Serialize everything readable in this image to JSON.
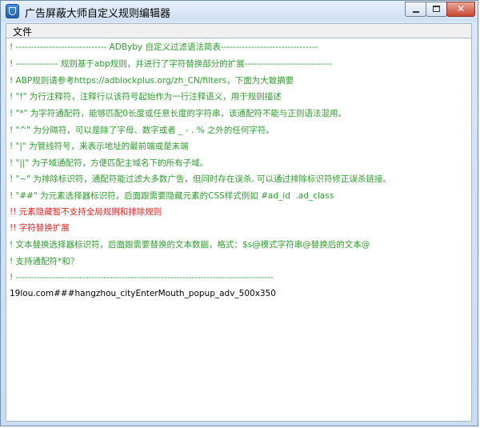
{
  "window": {
    "title": "广告屏蔽大师自定义规则编辑器"
  },
  "menu": {
    "file_label": "文件"
  },
  "editor": {
    "lines": [
      {
        "text": "! ------------------------------ ADByby 自定义过滤语法简表--------------------------------",
        "color": "green"
      },
      {
        "text": "! -------------- 规则基于abp规则，并进行了字符替换部分的扩展-----------------------------",
        "color": "green"
      },
      {
        "text": "! ABP规则请参考https://adblockplus.org/zh_CN/filters，下面为大致摘要",
        "color": "green"
      },
      {
        "text": "! \"!\" 为行注释符，注释行以该符号起始作为一行注释语义，用于规则描述",
        "color": "green"
      },
      {
        "text": "! \"*\" 为字符通配符，能够匹配0长度或任意长度的字符串，该通配符不能与正则语法混用。",
        "color": "green"
      },
      {
        "text": "! \"^\" 为分隔符，可以是除了字母、数字或者 _ - . % 之外的任何字符。",
        "color": "green"
      },
      {
        "text": "! \"|\" 为管线符号，来表示地址的最前端或是末端",
        "color": "green"
      },
      {
        "text": "! \"||\" 为子域通配符，方便匹配主域名下的所有子域。",
        "color": "green"
      },
      {
        "text": "! \"~\" 为排除标识符，通配符能过滤大多数广告，但同时存在误杀, 可以通过排除标识符修正误杀链接。",
        "color": "green"
      },
      {
        "text": "! \"##\" 为元素选择器标识符，后面跟需要隐藏元素的CSS样式例如 #ad_id  .ad_class",
        "color": "green"
      },
      {
        "text": "!! 元素隐藏暂不支持全局规则和排除规则",
        "color": "red"
      },
      {
        "text": "!! 字符替换扩展",
        "color": "red"
      },
      {
        "text": "! 文本替换选择器标识符，后面跟需要替换的文本数据，格式：$s@模式字符串@替换后的文本@",
        "color": "green"
      },
      {
        "text": "! 支持通配符*和？",
        "color": "green"
      },
      {
        "text": "! -------------------------------------------------------------------------------------",
        "color": "green"
      },
      {
        "text": "19lou.com###hangzhou_cityEnterMouth_popup_adv_500x350",
        "color": "black"
      }
    ]
  }
}
